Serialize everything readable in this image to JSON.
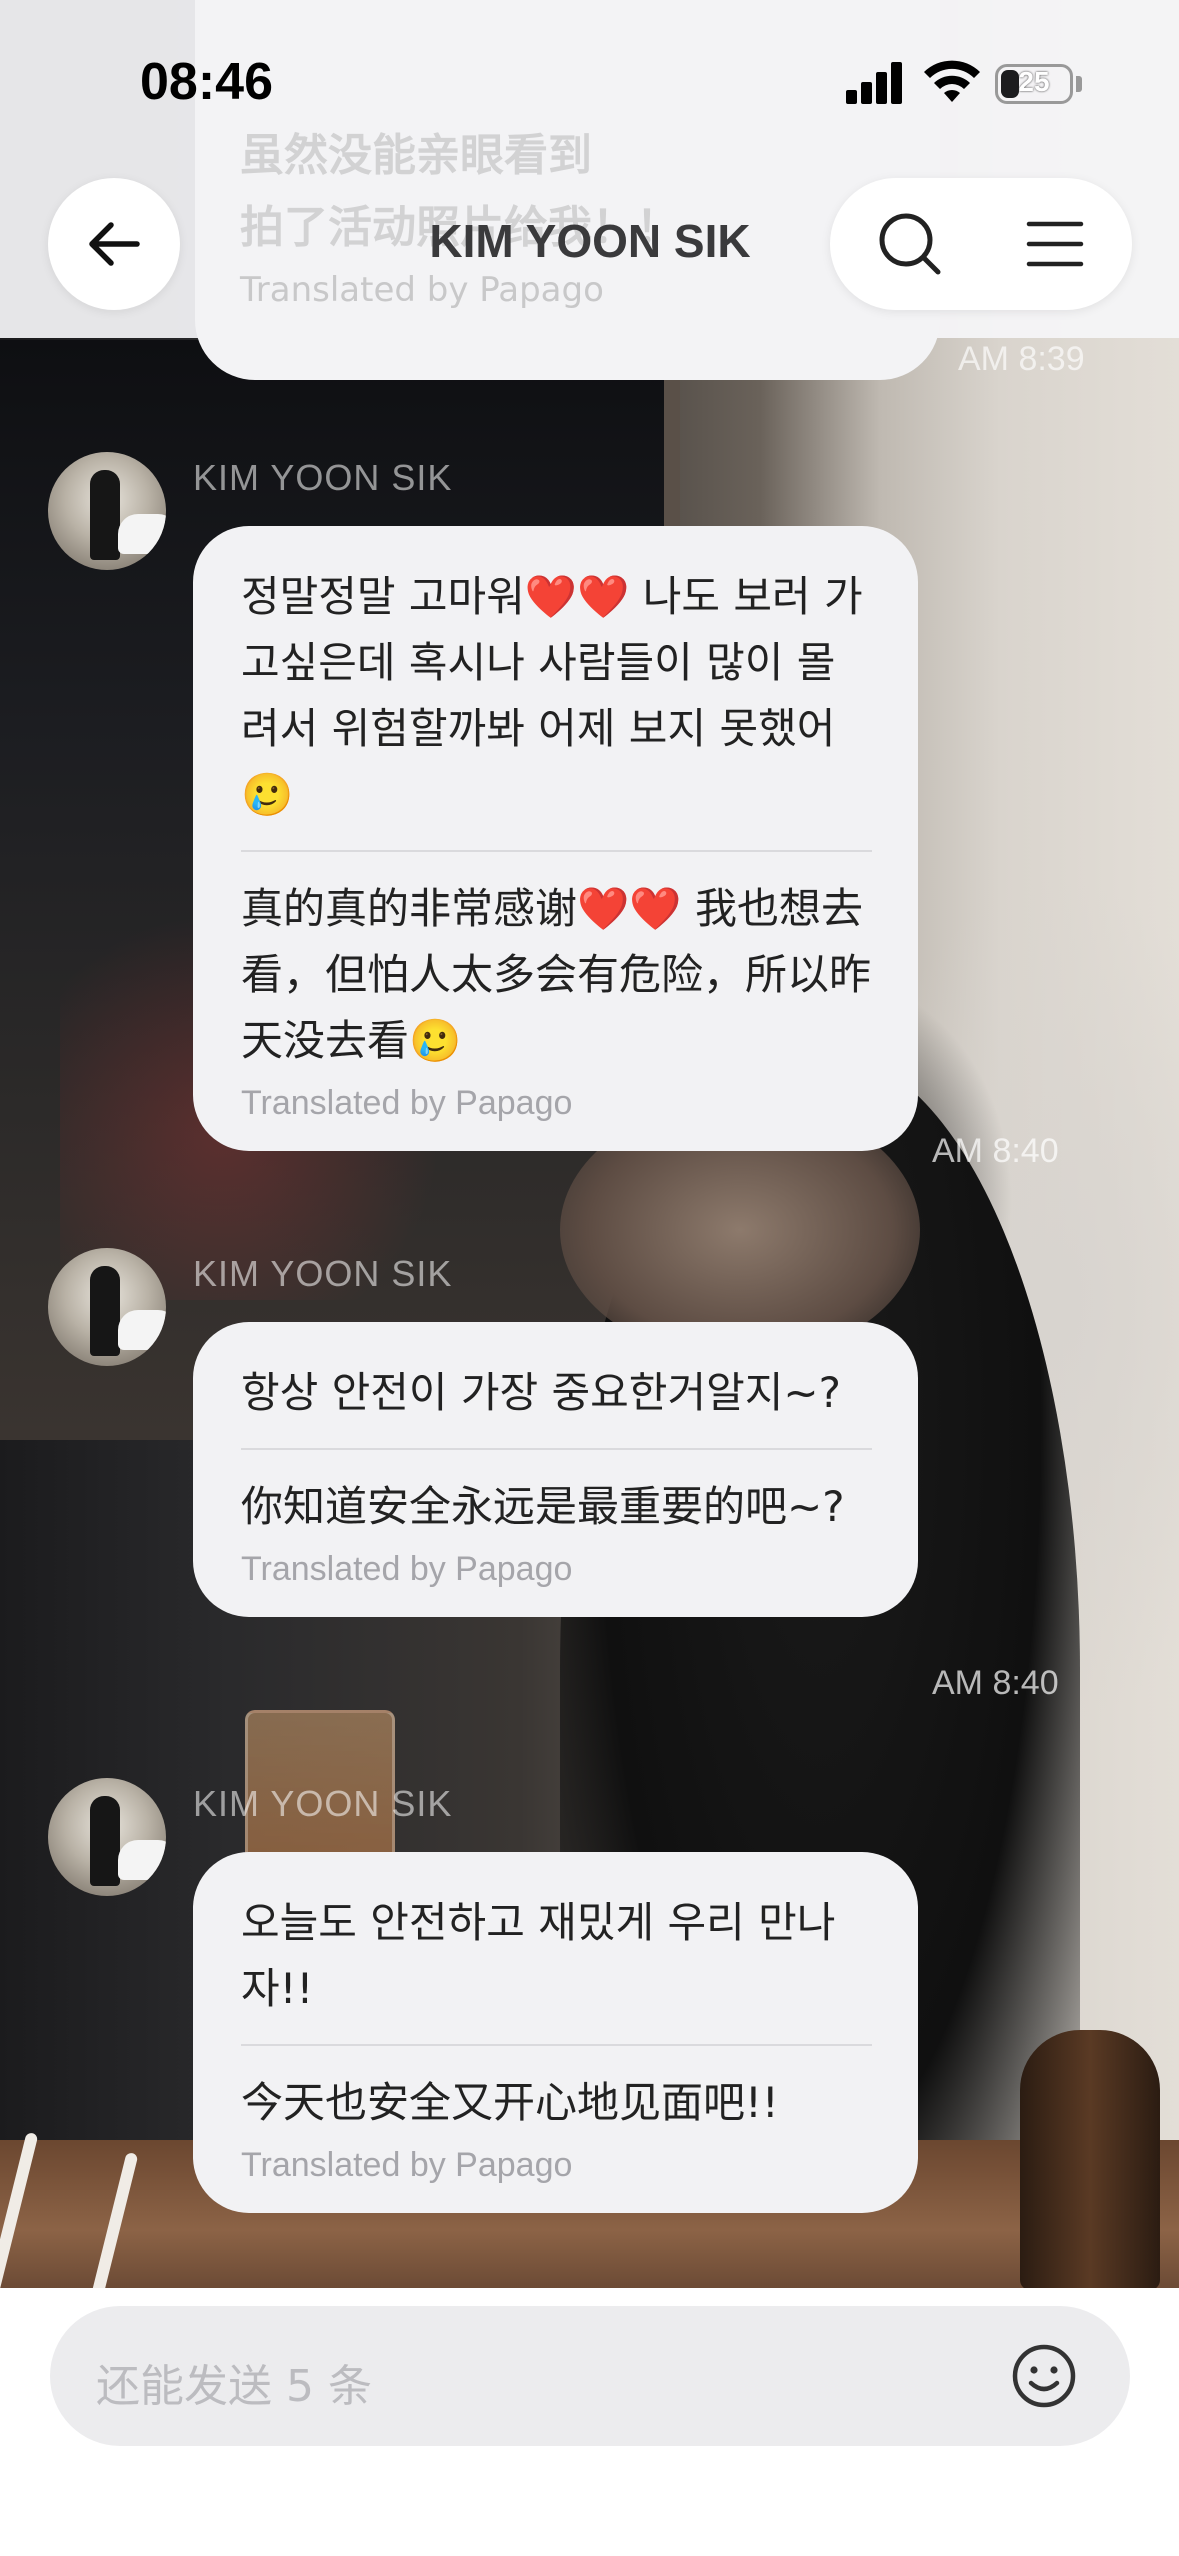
{
  "status_bar": {
    "time": "08:46",
    "battery": "25"
  },
  "header": {
    "title": "KIM YOON SIK"
  },
  "top_partial": {
    "ghost_line_1": "虽然没能亲眼看到",
    "ghost_line_2": "拍了活动照片给我！！",
    "translated_by": "Translated by Papago",
    "time": "AM 8:39"
  },
  "messages": [
    {
      "sender": "KIM YOON SIK",
      "original": "정말정말 고마워❤️❤️ 나도 보러 가고싶은데 혹시나 사람들이 많이 몰려서 위험할까봐 어제 보지 못했어🥲",
      "translated": "真的真的非常感谢❤️❤️ 我也想去看，但怕人太多会有危险，所以昨天没去看🥲",
      "translated_by": "Translated by Papago",
      "time": "AM 8:40"
    },
    {
      "sender": "KIM YOON SIK",
      "original": "항상 안전이 가장 중요한거알지~?",
      "translated": "你知道安全永远是最重要的吧~?",
      "translated_by": "Translated by Papago",
      "time": "AM 8:40"
    },
    {
      "sender": "KIM YOON SIK",
      "original": "오늘도 안전하고 재밌게 우리 만나자!!",
      "translated": "今天也安全又开心地见面吧!!",
      "translated_by": "Translated by Papago"
    }
  ],
  "composer": {
    "placeholder": "还能发送 5 条"
  },
  "icons": {
    "back": "arrow-left-icon",
    "search": "search-icon",
    "menu": "hamburger-menu-icon",
    "emoji": "smiley-icon"
  }
}
